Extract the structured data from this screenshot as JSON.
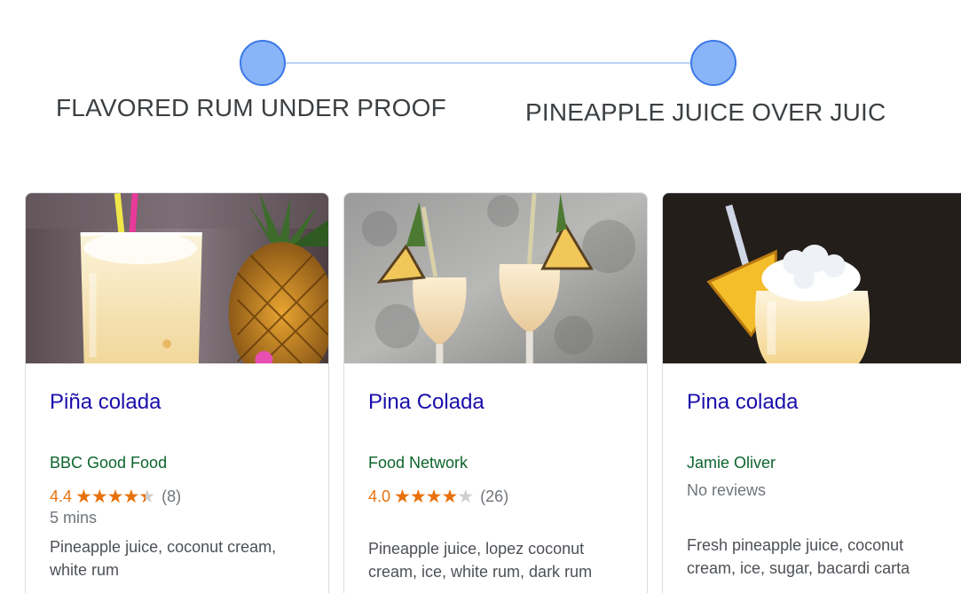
{
  "stepper": {
    "steps": [
      {
        "label": "FLAVORED RUM UNDER PROOF"
      },
      {
        "label": "PINEAPPLE JUICE OVER JUIC"
      }
    ]
  },
  "colors": {
    "step_dot": "#8ab4f8",
    "title_link": "#1a0dab",
    "source": "#0d652d",
    "rating": "#e8710a"
  },
  "recipes": [
    {
      "title": "Piña colada",
      "source": "BBC Good Food",
      "rating": "4.4",
      "rating_value": 4.4,
      "stars_text": "★★★★★",
      "review_count": "(8)",
      "time": "5 mins",
      "ingredients": "Pineapple juice, coconut cream, white rum",
      "image": "pina-colada-glass-with-pineapple-photo"
    },
    {
      "title": "Pina Colada",
      "source": "Food Network",
      "rating": "4.0",
      "rating_value": 4.0,
      "stars_text": "★★★★★",
      "review_count": "(26)",
      "ingredients": "Pineapple juice, lopez coconut cream, ice, white rum, dark rum",
      "image": "two-pina-coladas-on-stone-photo"
    },
    {
      "title": "Pina colada",
      "source": "Jamie Oliver",
      "no_reviews": "No reviews",
      "ingredients": "Fresh pineapple juice, coconut cream, ice, sugar, bacardi carta",
      "image": "pina-colada-dark-background-photo"
    }
  ]
}
